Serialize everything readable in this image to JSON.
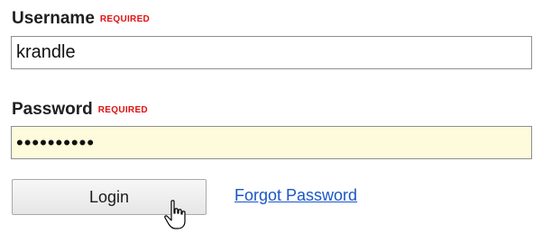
{
  "form": {
    "username": {
      "label": "Username",
      "required_tag": "REQUIRED",
      "value": "krandle"
    },
    "password": {
      "label": "Password",
      "required_tag": "REQUIRED",
      "value": "••••••••••"
    },
    "login_button": "Login",
    "forgot_link": "Forgot Password"
  },
  "colors": {
    "required": "#e01010",
    "link": "#1a56c8",
    "password_field_bg": "#fdfbdc"
  },
  "cursor": {
    "icon": "hand-pointer-icon"
  }
}
